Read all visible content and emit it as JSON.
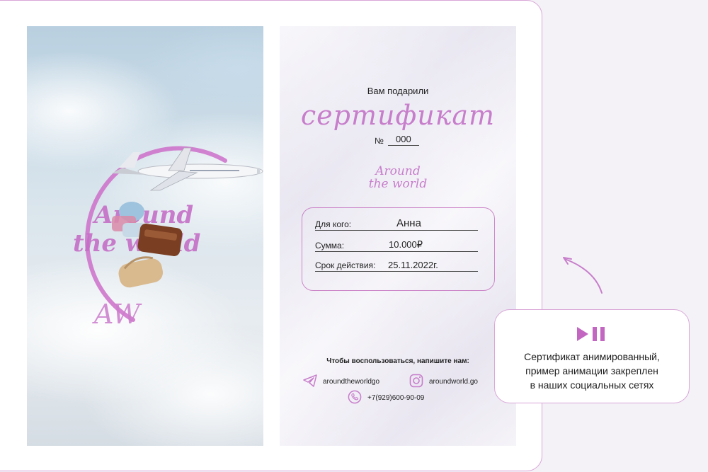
{
  "preview": {
    "logo_line1": "Around",
    "logo_line2": "the world",
    "monogram": "AW"
  },
  "certificate": {
    "gifted_text": "Вам подарили",
    "title": "сертификат",
    "number_label": "№",
    "number_value": "000",
    "brand_line1": "Around",
    "brand_line2": "the world",
    "fields": [
      {
        "label": "Для кого:",
        "value": "Анна"
      },
      {
        "label": "Сумма:",
        "value": "10.000₽"
      },
      {
        "label": "Срок действия:",
        "value": "25.11.2022г."
      }
    ],
    "use_text": "Чтобы воспользоваться, напишите нам:",
    "telegram": "aroundtheworldgo",
    "instagram": "aroundworld.go",
    "phone": "+7(929)600-90-09"
  },
  "info_card": {
    "caption_line1": "Сертификат анимированный,",
    "caption_line2": "пример анимации закреплен",
    "caption_line3": "в наших социальных сетях"
  },
  "colors": {
    "accent": "#c77ecb",
    "border": "#d9a6d8",
    "play_icon": "#c266c2"
  },
  "icons": {
    "play_pause": "play-pause-icon",
    "arrow": "curved-arrow-icon",
    "telegram": "telegram-icon",
    "instagram": "instagram-icon",
    "phone": "phone-icon"
  }
}
